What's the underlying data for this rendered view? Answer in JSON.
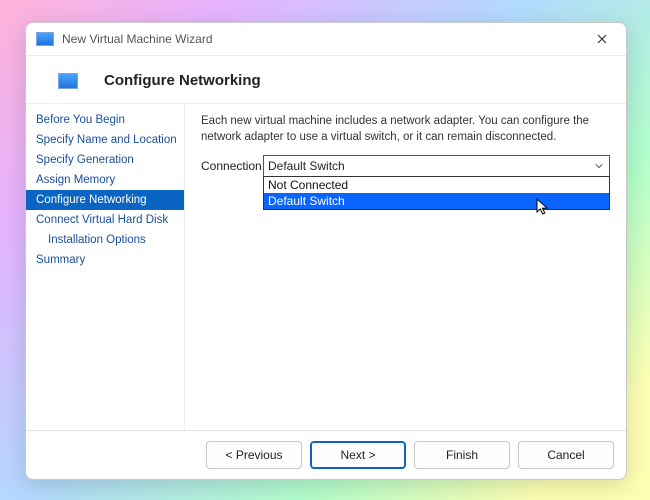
{
  "window": {
    "title": "New Virtual Machine Wizard"
  },
  "page": {
    "heading": "Configure Networking",
    "description": "Each new virtual machine includes a network adapter. You can configure the network adapter to use a virtual switch, or it can remain disconnected.",
    "connection_label": "Connection:",
    "connection_value": "Default Switch",
    "options": {
      "0": "Not Connected",
      "1": "Default Switch"
    }
  },
  "steps": {
    "0": "Before You Begin",
    "1": "Specify Name and Location",
    "2": "Specify Generation",
    "3": "Assign Memory",
    "4": "Configure Networking",
    "5": "Connect Virtual Hard Disk",
    "6": "Installation Options",
    "7": "Summary"
  },
  "buttons": {
    "previous": "< Previous",
    "next": "Next >",
    "finish": "Finish",
    "cancel": "Cancel"
  }
}
